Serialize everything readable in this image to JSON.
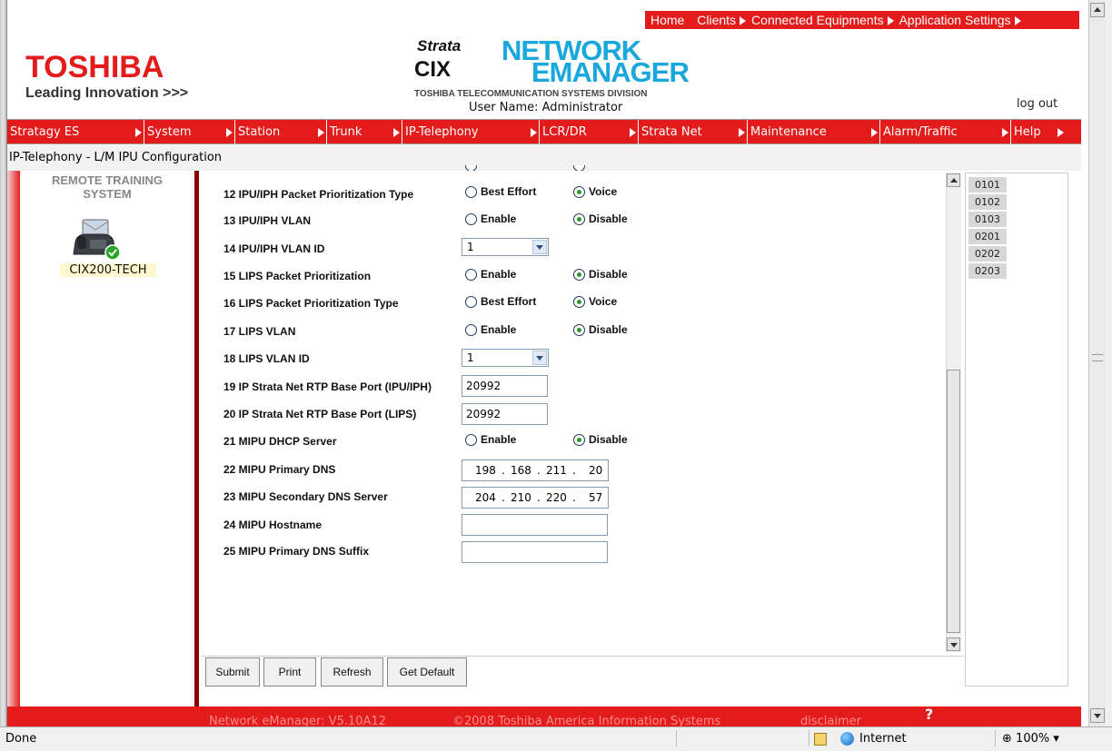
{
  "top_nav": {
    "items": [
      "Home",
      "Clients",
      "Connected Equipments",
      "Application Settings"
    ]
  },
  "header": {
    "brand": "TOSHIBA",
    "tagline": "Leading Innovation >>>",
    "product_strata": "Strata",
    "product_cix": "CIX",
    "product_name_1": "NETWORK",
    "product_name_2": "EMANAGER",
    "division": "TOSHIBA TELECOMMUNICATION SYSTEMS DIVISION",
    "user_name": "User Name: Administrator",
    "logout": "log out"
  },
  "menu": {
    "items": [
      "Stratagy ES",
      "System",
      "Station",
      "Trunk",
      "IP-Telephony",
      "LCR/DR",
      "Strata Net",
      "Maintenance",
      "Alarm/Traffic",
      "Help"
    ]
  },
  "breadcrumb": "IP-Telephony - L/M IPU Configuration",
  "left_panel": {
    "title_line1": "REMOTE TRAINING",
    "title_line2": "SYSTEM",
    "site_name": "CIX200-TECH"
  },
  "form": {
    "rows": [
      {
        "label": "12 IPU/IPH Packet Prioritization Type",
        "type": "radio",
        "options": [
          "Best Effort",
          "Voice"
        ],
        "selected": "Voice"
      },
      {
        "label": "13 IPU/IPH VLAN",
        "type": "radio",
        "options": [
          "Enable",
          "Disable"
        ],
        "selected": "Disable"
      },
      {
        "label": "14 IPU/IPH VLAN ID",
        "type": "select",
        "value": "1"
      },
      {
        "label": "15 LIPS Packet Prioritization",
        "type": "radio",
        "options": [
          "Enable",
          "Disable"
        ],
        "selected": "Disable"
      },
      {
        "label": "16 LIPS Packet Prioritization Type",
        "type": "radio",
        "options": [
          "Best Effort",
          "Voice"
        ],
        "selected": "Voice"
      },
      {
        "label": "17 LIPS VLAN",
        "type": "radio",
        "options": [
          "Enable",
          "Disable"
        ],
        "selected": "Disable"
      },
      {
        "label": "18 LIPS VLAN ID",
        "type": "select",
        "value": "1"
      },
      {
        "label": "19 IP Strata Net RTP Base Port (IPU/IPH)",
        "type": "text",
        "value": "20992"
      },
      {
        "label": "20 IP Strata Net RTP Base Port (LIPS)",
        "type": "text",
        "value": "20992"
      },
      {
        "label": "21 MIPU DHCP Server",
        "type": "radio",
        "options": [
          "Enable",
          "Disable"
        ],
        "selected": "Disable"
      },
      {
        "label": "22 MIPU Primary DNS",
        "type": "ip",
        "octets": [
          "198",
          "168",
          "211",
          "20"
        ]
      },
      {
        "label": "23 MIPU Secondary DNS Server",
        "type": "ip",
        "octets": [
          "204",
          "210",
          "220",
          "57"
        ]
      },
      {
        "label": "24 MIPU Hostname",
        "type": "text",
        "value": ""
      },
      {
        "label": "25 MIPU Primary DNS Suffix",
        "type": "text",
        "value": ""
      }
    ]
  },
  "extensions": [
    "0101",
    "0102",
    "0103",
    "0201",
    "0202",
    "0203"
  ],
  "buttons": {
    "submit": "Submit",
    "print": "Print",
    "refresh": "Refresh",
    "get_default": "Get Default"
  },
  "footer": {
    "version": "Network eManager: V5.10A12",
    "copyright": "©2008 Toshiba America Information Systems",
    "disclaimer": "disclaimer",
    "help_mark": "?"
  },
  "status_bar": {
    "status": "Done",
    "zone": "Internet",
    "zoom": "100%"
  },
  "colors": {
    "brand_red": "#e31b1b",
    "product_blue": "#1aa7dc",
    "radio_selected": "#2b9b2b"
  }
}
